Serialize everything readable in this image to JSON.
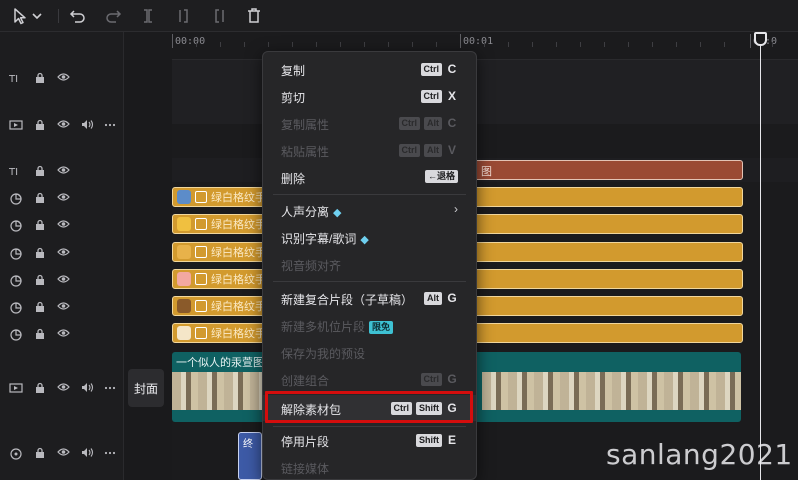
{
  "toolbar": {
    "tools": [
      {
        "icon": "pointer-select-icon"
      },
      {
        "icon": "chevron-down-icon"
      },
      {
        "icon": "undo-icon"
      },
      {
        "icon": "redo-icon"
      },
      {
        "icon": "split-icon"
      },
      {
        "icon": "trim-left-icon"
      },
      {
        "icon": "trim-right-icon"
      },
      {
        "icon": "delete-icon"
      }
    ]
  },
  "ruler": {
    "labels": [
      "00:00",
      "00:01",
      "00:0"
    ]
  },
  "cover_button": "封面",
  "clips": {
    "text_clip_suffix": "图",
    "sticker_clip_name": "绿白格纹手",
    "video_title": "一个似人的汞萱图",
    "audio_clip_label": "终"
  },
  "context_menu": {
    "items": [
      {
        "label": "复制",
        "keys": [
          "Ctrl"
        ],
        "letter": "C",
        "enabled": true
      },
      {
        "label": "剪切",
        "keys": [
          "Ctrl"
        ],
        "letter": "X",
        "enabled": true
      },
      {
        "label": "复制属性",
        "keys": [
          "Ctrl",
          "Alt"
        ],
        "letter": "C",
        "enabled": false
      },
      {
        "label": "粘贴属性",
        "keys": [
          "Ctrl",
          "Alt"
        ],
        "letter": "V",
        "enabled": false
      },
      {
        "label": "删除",
        "keys": [
          "←退格"
        ],
        "letter": "",
        "enabled": true
      },
      {
        "label": "人声分离",
        "enabled": true,
        "gem": true,
        "submenu": true
      },
      {
        "label": "识别字幕/歌词",
        "enabled": true,
        "gem": true
      },
      {
        "label": "视音频对齐",
        "enabled": false
      },
      {
        "label": "新建复合片段（子草稿）",
        "keys": [
          "Alt"
        ],
        "letter": "G",
        "enabled": true
      },
      {
        "label": "新建多机位片段",
        "enabled": false,
        "badge": "限免"
      },
      {
        "label": "保存为我的预设",
        "enabled": false
      },
      {
        "label": "创建组合",
        "keys": [
          "Ctrl"
        ],
        "letter": "G",
        "enabled": false
      },
      {
        "label": "解除素材包",
        "keys": [
          "Ctrl",
          "Shift"
        ],
        "letter": "G",
        "enabled": true,
        "highlighted": true
      },
      {
        "label": "停用片段",
        "keys": [
          "Shift"
        ],
        "letter": "E",
        "enabled": true
      },
      {
        "label": "链接媒体",
        "enabled": false
      }
    ]
  },
  "watermark": "sanlang2021"
}
